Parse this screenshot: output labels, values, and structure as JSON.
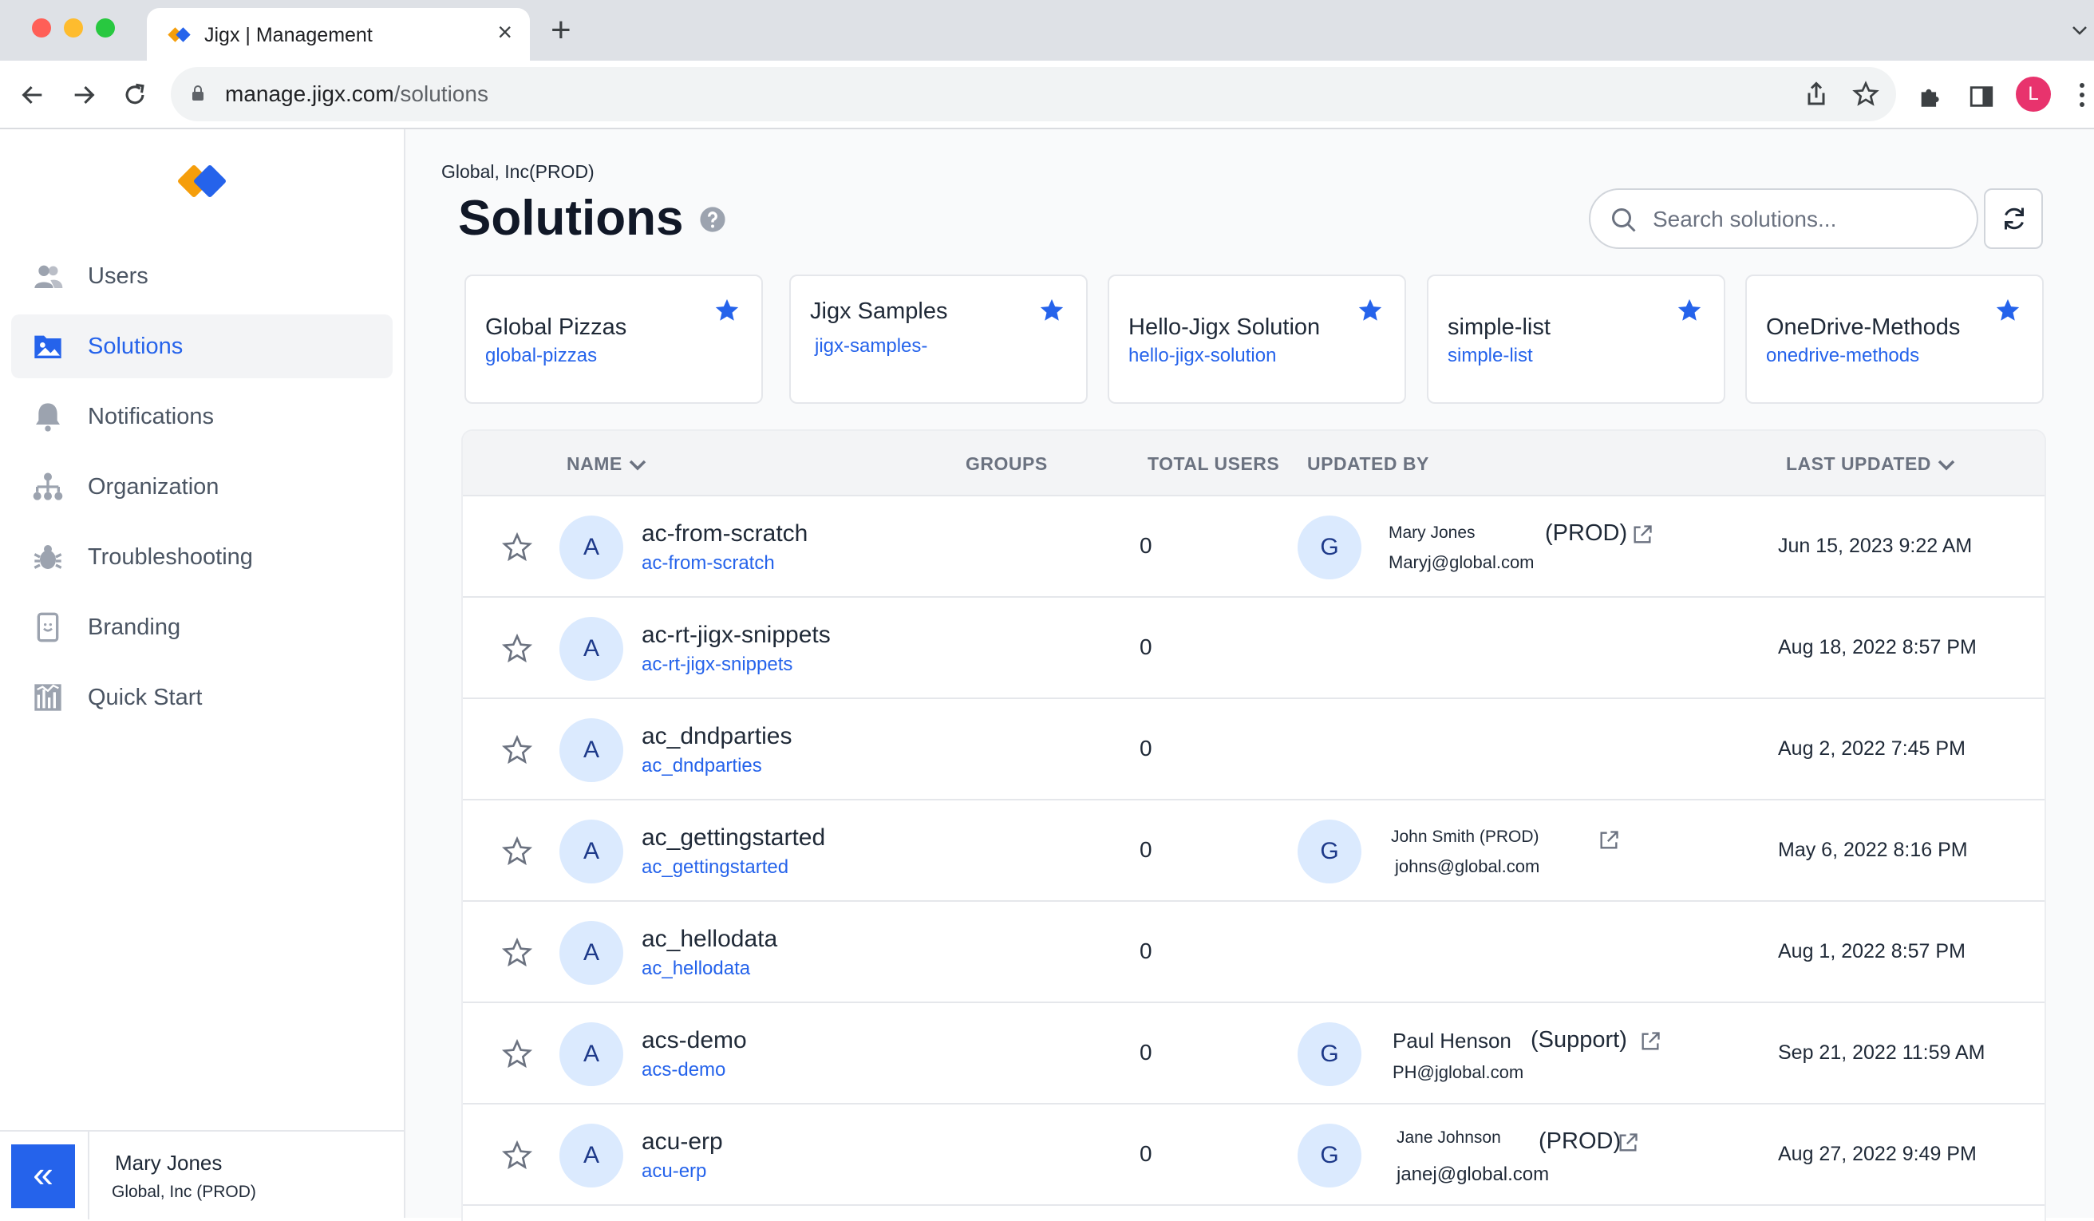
{
  "browser": {
    "tab_title": "Jigx | Management",
    "tab_close": "×",
    "new_tab": "+",
    "url_host": "manage.jigx.com",
    "url_path": "/solutions",
    "profile_initial": "L"
  },
  "sidebar": {
    "items": [
      {
        "label": "Users",
        "icon": "users-icon"
      },
      {
        "label": "Solutions",
        "icon": "solutions-icon",
        "active": true
      },
      {
        "label": "Notifications",
        "icon": "bell-icon"
      },
      {
        "label": "Organization",
        "icon": "org-chart-icon"
      },
      {
        "label": "Troubleshooting",
        "icon": "bug-icon"
      },
      {
        "label": "Branding",
        "icon": "device-icon"
      },
      {
        "label": "Quick Start",
        "icon": "quick-start-icon"
      }
    ],
    "footer": {
      "collapse_glyph": "«",
      "user_name": "Mary Jones",
      "org": "Global, Inc (PROD)"
    }
  },
  "main": {
    "org_label": "Global, Inc(PROD)",
    "title": "Solutions",
    "search_placeholder": "Search solutions...",
    "favorites": [
      {
        "name": "Global Pizzas",
        "slug": "global-pizzas"
      },
      {
        "name": "Jigx Samples",
        "slug": "jigx-samples-"
      },
      {
        "name": "Hello-Jigx Solution",
        "slug": "hello-jigx-solution"
      },
      {
        "name": "simple-list",
        "slug": "simple-list"
      },
      {
        "name": "OneDrive-Methods",
        "slug": "onedrive-methods"
      }
    ],
    "table": {
      "headers": {
        "name": "NAME",
        "groups": "GROUPS",
        "total_users": "TOTAL USERS",
        "updated_by": "UPDATED BY",
        "last_updated": "LAST UPDATED"
      },
      "rows": [
        {
          "initial": "A",
          "name": "ac-from-scratch",
          "slug": "ac-from-scratch",
          "total_users": "0",
          "updater": {
            "initial": "G",
            "name": "Mary Jones",
            "tag": "(PROD)",
            "email": "Maryj@global.com"
          },
          "last_updated": "Jun 15, 2023 9:22 AM"
        },
        {
          "initial": "A",
          "name": "ac-rt-jigx-snippets",
          "slug": "ac-rt-jigx-snippets",
          "total_users": "0",
          "updater": null,
          "last_updated": "Aug 18, 2022 8:57 PM"
        },
        {
          "initial": "A",
          "name": "ac_dndparties",
          "slug": "ac_dndparties",
          "total_users": "0",
          "updater": null,
          "last_updated": "Aug 2, 2022 7:45 PM"
        },
        {
          "initial": "A",
          "name": "ac_gettingstarted",
          "slug": "ac_gettingstarted",
          "total_users": "0",
          "updater": {
            "initial": "G",
            "name": "John Smith (PROD)",
            "tag": "",
            "email": "johns@global.com"
          },
          "last_updated": "May 6, 2022 8:16 PM"
        },
        {
          "initial": "A",
          "name": "ac_hellodata",
          "slug": "ac_hellodata",
          "total_users": "0",
          "updater": null,
          "last_updated": "Aug 1, 2022 8:57 PM"
        },
        {
          "initial": "A",
          "name": "acs-demo",
          "slug": "acs-demo",
          "total_users": "0",
          "updater": {
            "initial": "G",
            "name": "Paul Henson",
            "tag": "(Support)",
            "email": "PH@jglobal.com"
          },
          "last_updated": "Sep 21, 2022 11:59 AM"
        },
        {
          "initial": "A",
          "name": "acu-erp",
          "slug": "acu-erp",
          "total_users": "0",
          "updater": {
            "initial": "G",
            "name": "Jane Johnson",
            "tag": "(PROD)",
            "email": "janej@global.com"
          },
          "last_updated": "Aug 27, 2022 9:49 PM"
        }
      ]
    }
  },
  "colors": {
    "accent": "#2563eb",
    "avatar_bg": "#dbeafe",
    "logo_orange": "#f59e0b",
    "logo_blue": "#2563eb"
  }
}
